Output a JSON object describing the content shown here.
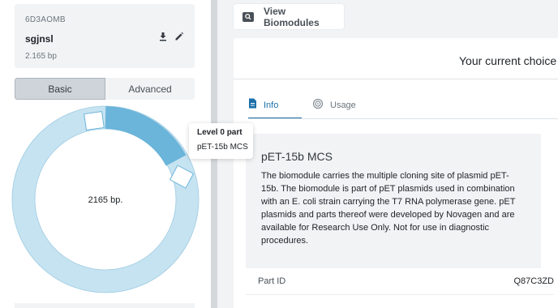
{
  "construct": {
    "id": "6D3AOMB",
    "name": "sgjnsl",
    "size": "2.165 bp",
    "icons": [
      "download-icon",
      "edit-icon"
    ]
  },
  "view_toggle": {
    "options": [
      "Basic",
      "Advanced"
    ],
    "selected": "Basic"
  },
  "plasmid_map": {
    "center_label": "2165 bp.",
    "ring_color": "#c6e3f1",
    "highlight_color": "#6bb4da"
  },
  "tooltip": {
    "title": "Level 0 part",
    "value": "pET-15b MCS"
  },
  "toolbar": {
    "view_biomodules_label": "View Biomodules",
    "view_biomodules_icon": "search-icon"
  },
  "main": {
    "choice_text": "Your current choice f",
    "tabs": [
      {
        "label": "Info",
        "icon": "document-icon",
        "active": true
      },
      {
        "label": "Usage",
        "icon": "usage-icon",
        "active": false
      }
    ],
    "description": {
      "title": "pET-15b MCS",
      "lines": [
        "The biomodule carries the multiple cloning site of plasmid pET-",
        "15b. The biomodule is part of pET plasmids used in combination",
        "with an E. coli strain carrying the T7 RNA polymerase gene. pET",
        "plasmids and parts thereof were developed by Novagen and are",
        "available for Research Use Only. Not for use in diagnostic",
        "procedures."
      ]
    },
    "details": [
      {
        "label": "Part ID",
        "value": "Q87C3ZD"
      }
    ]
  },
  "colors": {
    "accent": "#1b6fa8",
    "panel_bg": "#f1f3f5"
  }
}
